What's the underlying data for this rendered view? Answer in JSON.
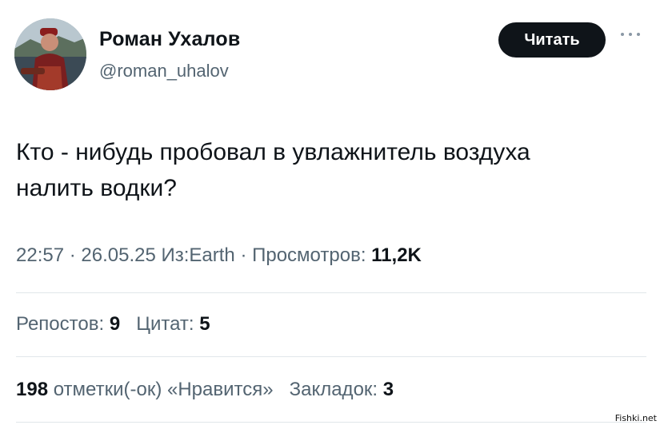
{
  "author": {
    "display_name": "Роман Ухалов",
    "handle": "@roman_uhalov"
  },
  "follow_button": {
    "label": "Читать"
  },
  "more_icon": "more-horizontal-icon",
  "tweet": {
    "text_lines": [
      "Кто - нибудь пробовал в увлажнитель воздуха",
      "налить водки?"
    ]
  },
  "meta": {
    "time": "22:57",
    "separator": " · ",
    "date": "26.05.25",
    "source": "Из:Earth",
    "views_label": "Просмотров:",
    "views_count": "11,2K"
  },
  "stats": {
    "reposts_label": "Репостов:",
    "reposts_count": "9",
    "quotes_label": "Цитат:",
    "quotes_count": "5",
    "likes_count": "198",
    "likes_label": "отметки(-ок) «Нравится»",
    "bookmarks_label": "Закладок:",
    "bookmarks_count": "3"
  },
  "watermark": "Fishki.net",
  "colors": {
    "text_primary": "#0f1419",
    "text_secondary": "#536471",
    "divider": "#e1e6ea",
    "button_bg": "#0f1419"
  }
}
